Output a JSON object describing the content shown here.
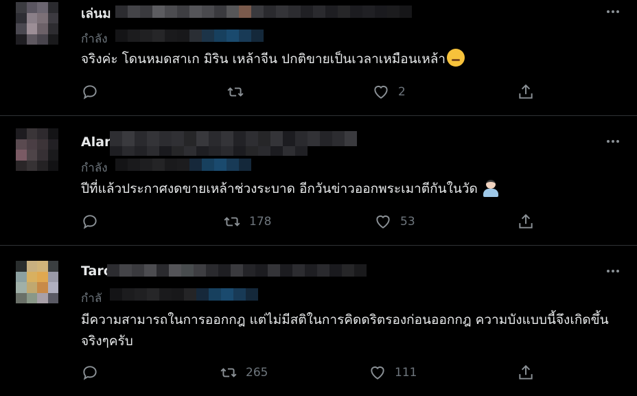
{
  "colors": {
    "background": "#000000",
    "divider": "#2f3336",
    "text": "#e7e9ea",
    "muted": "#6e767d",
    "mention": "#1d9bf0"
  },
  "tweets": [
    {
      "name": "เล่นม",
      "reply_prefix": "กำลัง",
      "text": "จริงค่ะ โดนหมดสาเก มิริน เหล้าจีน ปกติขายเป็นเวลาเหมือนเหล้า",
      "emoji": "pensive-face-emoji",
      "replies": "",
      "retweets": "",
      "likes": "2"
    },
    {
      "name": "Alar",
      "reply_prefix": "กำลัง",
      "text": "ปีที่แล้วประกาศงดขายเหล้าช่วงระบาด อีกวันข่าวออกพระเมาตีกันในวัด",
      "emoji": "person-shrugging-emoji",
      "replies": "",
      "retweets": "178",
      "likes": "53"
    },
    {
      "name": "Taro",
      "reply_prefix": "กำลั",
      "text": "มีความสามารถในการออกกฎ แต่ไม่มีสติในการคิดดริตรองก่อนออกกฎ ความบังแบบนี้จึงเกิดขึ้นจริงๆครับ",
      "emoji": "",
      "replies": "",
      "retweets": "265",
      "likes": "111"
    }
  ]
}
